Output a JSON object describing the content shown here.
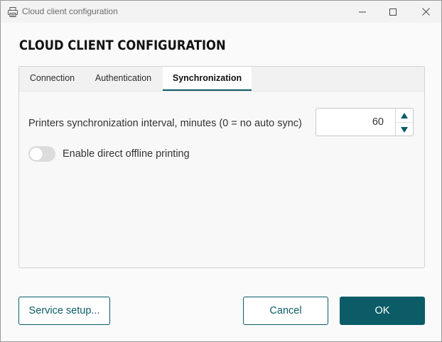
{
  "window": {
    "title": "Cloud client configuration",
    "icon": "printer-icon",
    "controls": [
      "minimize-icon",
      "maximize-icon",
      "close-icon"
    ]
  },
  "heading": "CLOUD CLIENT CONFIGURATION",
  "tabs": [
    {
      "label": "Connection",
      "active": false
    },
    {
      "label": "Authentication",
      "active": false
    },
    {
      "label": "Synchronization",
      "active": true
    }
  ],
  "sync": {
    "interval_label": "Printers synchronization interval, minutes (0 = no auto sync)",
    "interval_value": "60",
    "offline_label": "Enable direct offline printing",
    "offline_enabled": false
  },
  "buttons": {
    "service_setup": "Service setup...",
    "cancel": "Cancel",
    "ok": "OK"
  },
  "colors": {
    "accent": "#0b5c66",
    "toggle_off": "#dcdcdc"
  }
}
